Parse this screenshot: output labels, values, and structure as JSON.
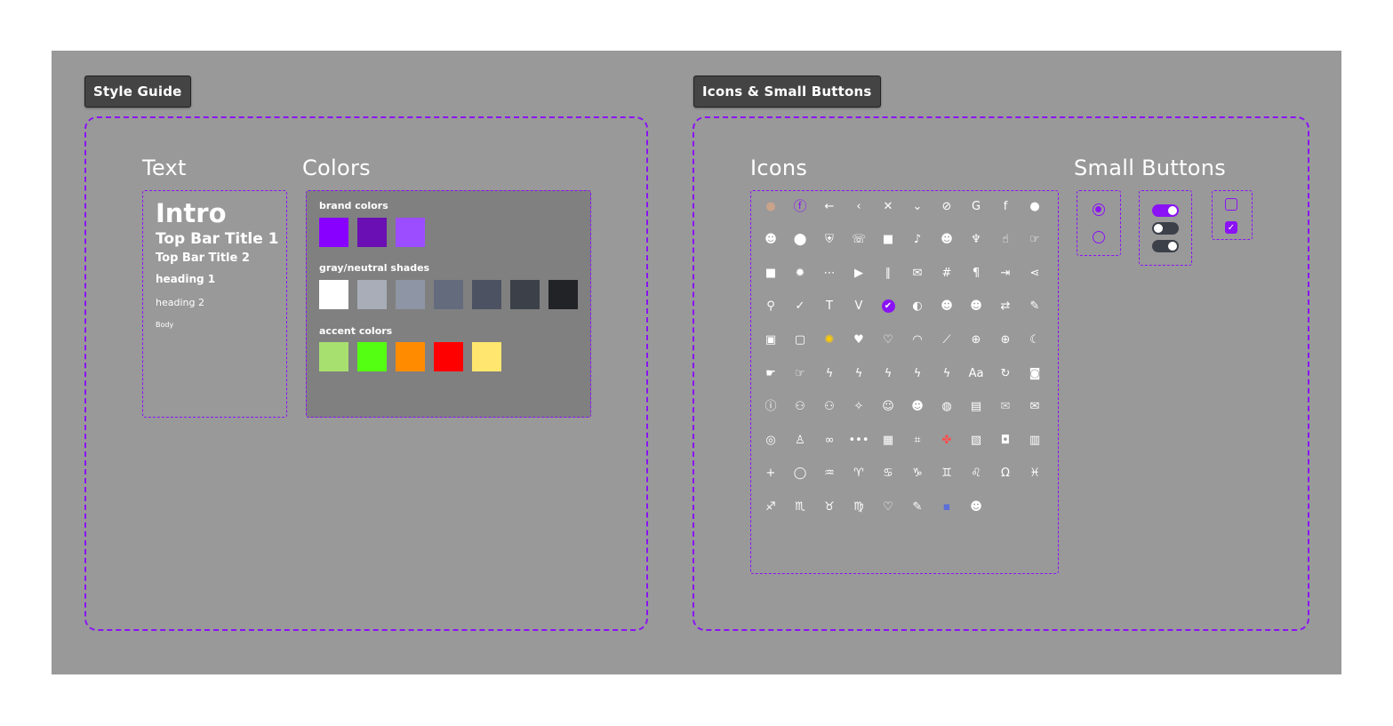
{
  "style_guide": {
    "label": "Style Guide",
    "text_section": {
      "title": "Text",
      "intro": "Intro",
      "top_bar_title_1": "Top Bar Title 1",
      "top_bar_title_2": "Top Bar Title 2",
      "heading_1": "heading 1",
      "heading_2": "heading 2",
      "body": "Body"
    },
    "colors_section": {
      "title": "Colors",
      "brand_label": "brand colors",
      "brand_colors": [
        "#8800ff",
        "#6a0fb3",
        "#9b4dff"
      ],
      "gray_label": "gray/neutral shades",
      "gray_colors": [
        "#ffffff",
        "#a8adb8",
        "#8e95a4",
        "#636b7d",
        "#4c5262",
        "#3c4049",
        "#222326"
      ],
      "accent_label": "accent colors",
      "accent_colors": [
        "#a8e070",
        "#55ff11",
        "#ff8c00",
        "#ff0000",
        "#ffe66e"
      ]
    }
  },
  "icons_buttons": {
    "label": "Icons & Small Buttons",
    "icons_title": "Icons",
    "small_buttons_title": "Small Buttons",
    "icons": [
      [
        "avatar-icon",
        "facebook-circle-icon",
        "arrow-left-icon",
        "chevron-left-icon",
        "close-icon",
        "chevron-down-icon",
        "eye-off-icon",
        "google-icon",
        "facebook-icon",
        "apple-icon"
      ],
      [
        "users-icon",
        "location-pin-icon",
        "shield-icon",
        "phone-icon",
        "lock-icon",
        "bell-icon",
        "user-icon",
        "microphone-icon",
        "thumbs-up-filled-icon",
        "thumbs-up-outline-icon"
      ],
      [
        "chat-bubble-icon",
        "settings-icon",
        "ellipsis-icon",
        "play-icon",
        "pause-icon",
        "mail-icon",
        "hash-icon",
        "paragraph-icon",
        "logout-icon",
        "share-icon"
      ],
      [
        "search-icon",
        "check-icon",
        "text-t-icon",
        "text-v-icon",
        "check-circle-icon",
        "contrast-icon",
        "user-round-icon",
        "user-alt-icon",
        "repeat-icon",
        "pencil-icon"
      ],
      [
        "square-frame-icon",
        "tablet-icon",
        "color-wheel-icon",
        "heart-filled-icon",
        "heart-outline-icon",
        "eye-arc-icon",
        "eyedropper-icon",
        "globe-icon",
        "plus-circle-icon",
        "moon-icon"
      ],
      [
        "hand-point-icon",
        "hand-outline-icon",
        "lightning-spark-icon",
        "lightning-icon",
        "lightning-dot-icon",
        "lightning-outline-icon",
        "lightning-notify-icon",
        "font-aa-icon",
        "refresh-icon",
        "camera-icon"
      ],
      [
        "info-circle-icon",
        "group-add-icon",
        "group-icon",
        "horoscope-icon",
        "smiley-outline-icon",
        "smiley-filled-icon",
        "earth-icon",
        "book-icon",
        "mail-notify-icon",
        "mail-open-icon"
      ],
      [
        "instagram-icon",
        "snapchat-icon",
        "link-icon",
        "more-dots-icon",
        "image-icon",
        "crop-icon",
        "google-photos-icon",
        "image-edit-icon",
        "camera-outline-icon",
        "trash-icon"
      ],
      [
        "plus-icon",
        "speech-bubble-icon",
        "aquarius-icon",
        "aries-icon",
        "cancer-icon",
        "capricorn-icon",
        "gemini-icon",
        "leo-icon",
        "libra-icon",
        "pisces-icon"
      ],
      [
        "sagittarius-icon",
        "scorpio-icon",
        "taurus-icon",
        "virgo-icon",
        "heart-line-icon",
        "edit-square-icon",
        "robot-icon",
        "grin-icon"
      ]
    ],
    "radio_states": [
      "selected",
      "unselected"
    ],
    "toggle_states": [
      "on",
      "off",
      "off"
    ],
    "checkbox_states": [
      "unchecked",
      "checked"
    ]
  }
}
